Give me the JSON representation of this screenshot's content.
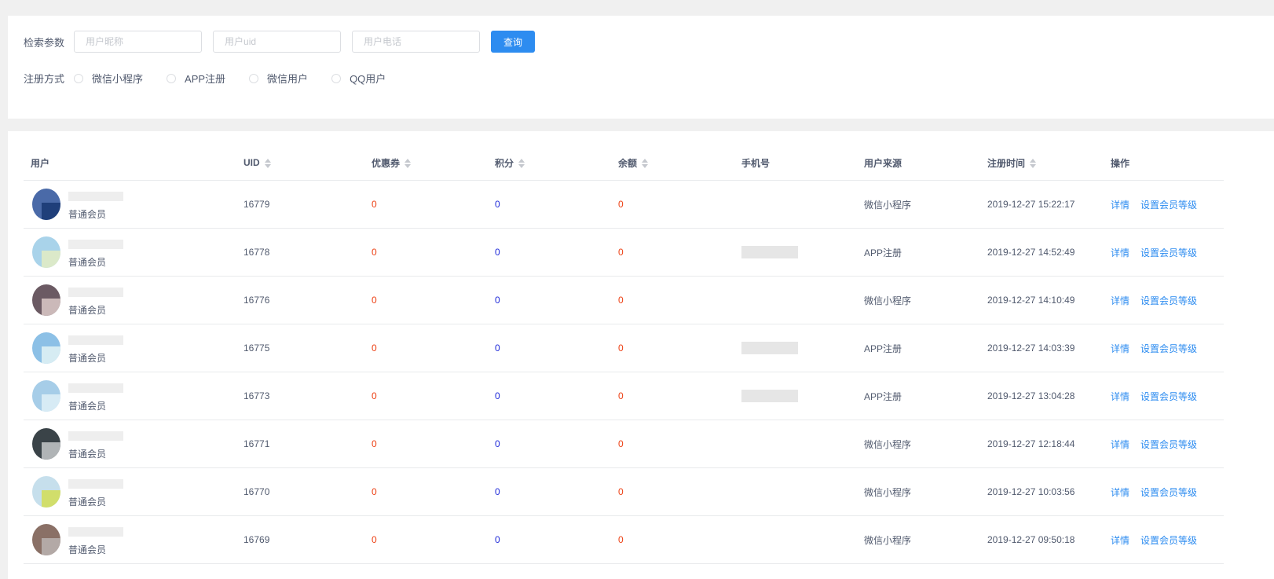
{
  "search": {
    "label": "检索参数",
    "nickname_placeholder": "用户昵称",
    "uid_placeholder": "用户uid",
    "phone_placeholder": "用户电话",
    "query_button": "查询",
    "reg_label": "注册方式",
    "reg_options": [
      "微信小程序",
      "APP注册",
      "微信用户",
      "QQ用户"
    ]
  },
  "table": {
    "columns": [
      "用户",
      "UID",
      "优惠券",
      "积分",
      "余额",
      "手机号",
      "用户来源",
      "注册时间",
      "操作"
    ],
    "actions": {
      "detail": "详情",
      "set_level": "设置会员等级"
    },
    "rows": [
      {
        "level": "普通会员",
        "uid": "16779",
        "coupon": "0",
        "points": "0",
        "balance": "0",
        "has_phone": false,
        "source": "微信小程序",
        "time": "2019-12-27 15:22:17",
        "avatar_colors": [
          "#4a6aa8",
          "#1f3f7a"
        ]
      },
      {
        "level": "普通会员",
        "uid": "16778",
        "coupon": "0",
        "points": "0",
        "balance": "0",
        "has_phone": true,
        "source": "APP注册",
        "time": "2019-12-27 14:52:49",
        "avatar_colors": [
          "#a9d3ea",
          "#dbe9c9"
        ]
      },
      {
        "level": "普通会员",
        "uid": "16776",
        "coupon": "0",
        "points": "0",
        "balance": "0",
        "has_phone": false,
        "source": "微信小程序",
        "time": "2019-12-27 14:10:49",
        "avatar_colors": [
          "#6b5a63",
          "#cbb9b9"
        ]
      },
      {
        "level": "普通会员",
        "uid": "16775",
        "coupon": "0",
        "points": "0",
        "balance": "0",
        "has_phone": true,
        "source": "APP注册",
        "time": "2019-12-27 14:03:39",
        "avatar_colors": [
          "#8cc0e6",
          "#d6ecf3"
        ]
      },
      {
        "level": "普通会员",
        "uid": "16773",
        "coupon": "0",
        "points": "0",
        "balance": "0",
        "has_phone": true,
        "source": "APP注册",
        "time": "2019-12-27 13:04:28",
        "avatar_colors": [
          "#a6cde8",
          "#d7ebf5"
        ]
      },
      {
        "level": "普通会员",
        "uid": "16771",
        "coupon": "0",
        "points": "0",
        "balance": "0",
        "has_phone": false,
        "source": "微信小程序",
        "time": "2019-12-27 12:18:44",
        "avatar_colors": [
          "#3a4348",
          "#b0b4b6"
        ]
      },
      {
        "level": "普通会员",
        "uid": "16770",
        "coupon": "0",
        "points": "0",
        "balance": "0",
        "has_phone": false,
        "source": "微信小程序",
        "time": "2019-12-27 10:03:56",
        "avatar_colors": [
          "#c6dfec",
          "#d1de6b"
        ]
      },
      {
        "level": "普通会员",
        "uid": "16769",
        "coupon": "0",
        "points": "0",
        "balance": "0",
        "has_phone": false,
        "source": "微信小程序",
        "time": "2019-12-27 09:50:18",
        "avatar_colors": [
          "#8a7066",
          "#b3a9a6"
        ]
      }
    ]
  }
}
